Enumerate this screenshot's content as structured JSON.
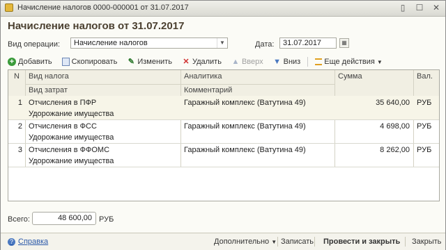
{
  "window": {
    "title": "Начисление налогов 0000-000001 от 31.07.2017",
    "minimize": "▯",
    "maximize": "☐",
    "close": "✕"
  },
  "header": {
    "title": "Начисление налогов от 31.07.2017",
    "op_label": "Вид операции:",
    "op_value": "Начисление налогов",
    "date_label": "Дата:",
    "date_value": "31.07.2017"
  },
  "toolbar": {
    "add": "Добавить",
    "copy": "Скопировать",
    "edit": "Изменить",
    "delete": "Удалить",
    "up": "Вверх",
    "down": "Вниз",
    "more": "Еще действия"
  },
  "table": {
    "columns": {
      "n": "N",
      "tax": "Вид налога",
      "cost": "Вид затрат",
      "analytics": "Аналитика",
      "comment": "Комментарий",
      "sum": "Сумма",
      "cur": "Вал."
    },
    "rows": [
      {
        "n": "1",
        "tax": "Отчисления в ПФР",
        "cost": "Удорожание имущества",
        "analytics": "Гаражный комплекс (Ватутина 49)",
        "sum": "35 640,00",
        "cur": "РУБ"
      },
      {
        "n": "2",
        "tax": "Отчисления в ФСС",
        "cost": "Удорожание имущества",
        "analytics": "Гаражный комплекс (Ватутина 49)",
        "sum": "4 698,00",
        "cur": "РУБ"
      },
      {
        "n": "3",
        "tax": "Отчисления в ФФОМС",
        "cost": "Удорожание имущества",
        "analytics": "Гаражный комплекс (Ватутина 49)",
        "sum": "8 262,00",
        "cur": "РУБ"
      }
    ]
  },
  "totals": {
    "label": "Всего:",
    "value": "48 600,00",
    "currency": "РУБ"
  },
  "footer": {
    "help": "Справка",
    "more": "Дополнительно",
    "save": "Записать",
    "post_close": "Провести и закрыть",
    "close": "Закрыть"
  }
}
